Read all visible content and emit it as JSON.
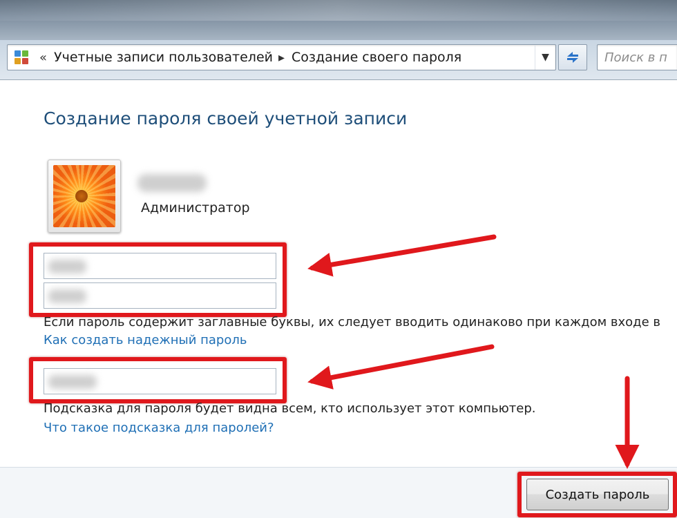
{
  "window": {
    "breadcrumb": [
      "Учетные записи пользователей",
      "Создание своего пароля"
    ],
    "breadcrumb_prefix": "«",
    "breadcrumb_separator": "▸",
    "search_placeholder": "Поиск в п",
    "icons": {
      "control_panel": "control-panel-icon",
      "dropdown": "chevron-down-icon",
      "refresh": "refresh-icon"
    }
  },
  "main": {
    "title": "Создание пароля своей учетной записи",
    "user": {
      "role": "Администратор"
    },
    "new_password": {
      "value": ""
    },
    "confirm_password": {
      "value": ""
    },
    "case_notice": "Если пароль содержит заглавные буквы, их следует вводить одинаково при каждом входе в",
    "strong_password_link": "Как создать надежный пароль",
    "hint": {
      "value": ""
    },
    "hint_notice": "Подсказка для пароля будет видна всем, кто использует этот компьютер.",
    "hint_help_link": "Что такое подсказка для паролей?",
    "create_button": "Создать пароль"
  },
  "colors": {
    "title": "#1e4e79",
    "link": "#1f6fb5",
    "annotation_red": "#e0181c"
  }
}
